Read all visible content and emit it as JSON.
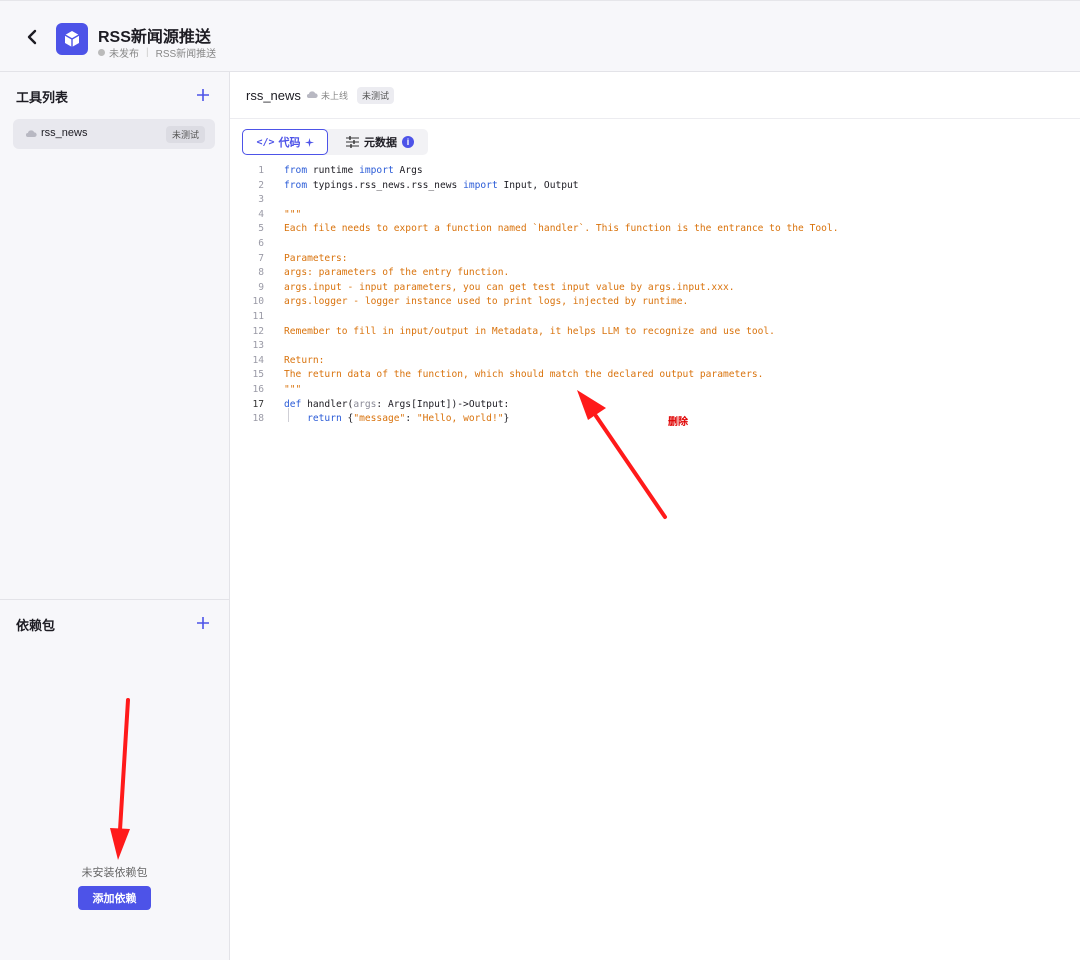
{
  "header": {
    "title": "RSS新闻源推送",
    "status": "未发布",
    "breadcrumb": "RSS新闻推送"
  },
  "sidebar": {
    "tools_title": "工具列表",
    "tools": [
      {
        "name": "rss_news",
        "badge": "未测试"
      }
    ],
    "deps_title": "依赖包",
    "deps_empty": "未安装依赖包",
    "add_dep_label": "添加依赖"
  },
  "main": {
    "tool_name": "rss_news",
    "online_status": "未上线",
    "test_badge": "未测试",
    "tabs": {
      "code_label": "代码",
      "metadata_label": "元数据",
      "info_glyph": "i"
    },
    "code_lines": [
      {
        "n": "1",
        "segs": [
          [
            "kw",
            "from"
          ],
          [
            "plain",
            " runtime "
          ],
          [
            "kw",
            "import"
          ],
          [
            "plain",
            " Args"
          ]
        ]
      },
      {
        "n": "2",
        "segs": [
          [
            "kw",
            "from"
          ],
          [
            "plain",
            " typings.rss_news.rss_news "
          ],
          [
            "kw",
            "import"
          ],
          [
            "plain",
            " Input, Output"
          ]
        ]
      },
      {
        "n": "3",
        "segs": []
      },
      {
        "n": "4",
        "segs": [
          [
            "doc",
            "\"\"\""
          ]
        ]
      },
      {
        "n": "5",
        "segs": [
          [
            "doc",
            "Each file needs to export a function named `handler`. This function is the entrance to the Tool."
          ]
        ]
      },
      {
        "n": "6",
        "segs": []
      },
      {
        "n": "7",
        "segs": [
          [
            "doc",
            "Parameters:"
          ]
        ]
      },
      {
        "n": "8",
        "segs": [
          [
            "doc",
            "args: parameters of the entry function."
          ]
        ]
      },
      {
        "n": "9",
        "segs": [
          [
            "doc",
            "args.input - input parameters, you can get test input value by args.input.xxx."
          ]
        ]
      },
      {
        "n": "10",
        "segs": [
          [
            "doc",
            "args.logger - logger instance used to print logs, injected by runtime."
          ]
        ]
      },
      {
        "n": "11",
        "segs": []
      },
      {
        "n": "12",
        "segs": [
          [
            "doc",
            "Remember to fill in input/output in Metadata, it helps LLM to recognize and use tool."
          ]
        ]
      },
      {
        "n": "13",
        "segs": []
      },
      {
        "n": "14",
        "segs": [
          [
            "doc",
            "Return:"
          ]
        ]
      },
      {
        "n": "15",
        "segs": [
          [
            "doc",
            "The return data of the function, which should match the declared output parameters."
          ]
        ]
      },
      {
        "n": "16",
        "segs": [
          [
            "doc",
            "\"\"\""
          ]
        ]
      },
      {
        "n": "17",
        "segs": [
          [
            "kw",
            "def"
          ],
          [
            "plain",
            " handler("
          ],
          [
            "param",
            "args"
          ],
          [
            "plain",
            ": Args[Input])->Output:"
          ]
        ],
        "active": true
      },
      {
        "n": "18",
        "segs": [
          [
            "plain",
            "    "
          ],
          [
            "kw",
            "return"
          ],
          [
            "plain",
            " {"
          ],
          [
            "str",
            "\"message\""
          ],
          [
            "plain",
            ": "
          ],
          [
            "str",
            "\"Hello, world!\""
          ],
          [
            "plain",
            "}"
          ]
        ]
      }
    ]
  },
  "annotation": {
    "label": "删除",
    "color": "#ff1a1a"
  },
  "colors": {
    "accent": "#4d53e8",
    "docstring": "#d9730d",
    "keyword": "#2a5bd7"
  },
  "icons": [
    "back-arrow-icon",
    "app-cube-icon",
    "plus-icon",
    "cloud-icon",
    "code-icon",
    "sparkle-icon",
    "sliders-icon",
    "info-icon"
  ]
}
